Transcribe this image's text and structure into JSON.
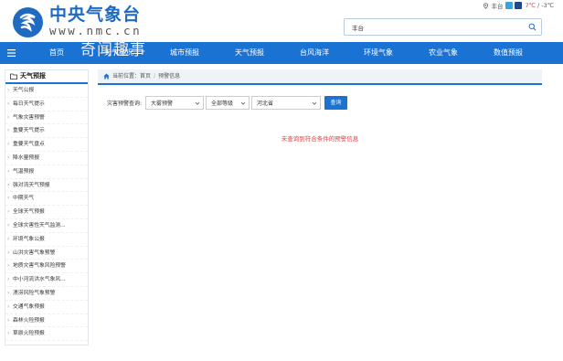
{
  "header": {
    "logo_cn": "中央气象台",
    "logo_en": "www.nmc.cn",
    "location": "丰台",
    "temp_high": "7℃",
    "temp_sep": " / ",
    "temp_low": "-3℃",
    "search_value": "丰台",
    "icons": {
      "location": "location-pin-icon",
      "weather_day": "sun-icon",
      "weather_night": "moon-icon",
      "search": "search-icon"
    }
  },
  "nav": {
    "items": [
      "首页",
      "天气实况",
      "城市预报",
      "天气预报",
      "台风海洋",
      "环境气象",
      "农业气象",
      "数值预报"
    ],
    "watermark": "奇闻趣事"
  },
  "sidebar": {
    "title": "天气预报",
    "items": [
      "天气公报",
      "每日天气提示",
      "气象灾害预警",
      "重要天气提示",
      "重要天气盘点",
      "降水量预报",
      "气温预报",
      "强对流天气预报",
      "中期天气",
      "全球天气预报",
      "全球灾害性天气监测...",
      "环境气象公报",
      "山洪灾害气象预警",
      "地质灾害气象风险预警",
      "中小河流洪水气象风...",
      "渍涝风险气象预警",
      "交通气象预报",
      "森林火险预报",
      "草原火险预报"
    ]
  },
  "breadcrumb": {
    "label": "当前位置：",
    "home": "首页",
    "sep": "/",
    "current": "预警信息"
  },
  "filter": {
    "label": "灾害预警查询:",
    "type_select": "大雾预警",
    "level_select": "全部等级",
    "province_select": "河北省",
    "query_button": "查询"
  },
  "result": {
    "empty_message": "未查询到符合条件的预警信息"
  },
  "colors": {
    "brand_blue": "#1a72d2",
    "logo_blue": "#1f6bc2",
    "error_red": "#e04040"
  }
}
